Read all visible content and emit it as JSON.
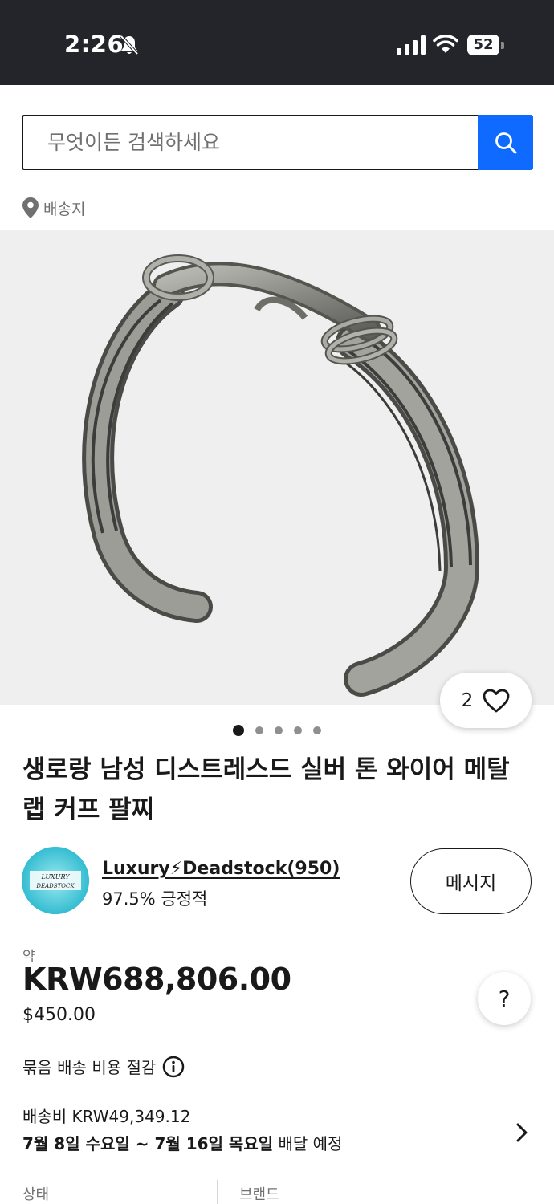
{
  "status_bar": {
    "time": "2:26",
    "battery": "52",
    "icons": [
      "bell-slash-icon",
      "cellular-signal-icon",
      "wifi-icon",
      "battery-icon"
    ]
  },
  "search": {
    "placeholder": "무엇이든 검색하세요",
    "button_icon": "search-icon",
    "accent_color": "#0f6bff"
  },
  "ship_to": {
    "icon": "location-pin-icon",
    "label": "배송지"
  },
  "gallery": {
    "watch_count": "2",
    "watch_icon": "heart-icon",
    "total_images": 5,
    "active_index": 0
  },
  "item": {
    "title": "생로랑 남성 디스트레스드 실버 톤 와이어 메탈 랩 커프 팔찌"
  },
  "seller": {
    "name": "Luxury⚡Deadstock(950)",
    "rating": "97.5% 긍정적",
    "message_button": "메시지",
    "logo_text_line1": "LUXURY",
    "logo_text_line2": "DEADSTOCK"
  },
  "price": {
    "approx_label": "약",
    "krw": "KRW688,806.00",
    "usd": "$450.00",
    "help_label": "?"
  },
  "combined_shipping": {
    "label": "묶음 배송 비용 절감",
    "icon": "info-icon"
  },
  "shipping": {
    "cost": "배송비 KRW49,349.12",
    "date_start": "7월 8일 수요일",
    "date_sep": " ~ ",
    "date_end": "7월 16일 목요일",
    "date_suffix": " 배달 예정",
    "chevron": "chevron-right-icon"
  },
  "details": {
    "condition_label": "상태",
    "brand_label": "브랜드"
  }
}
